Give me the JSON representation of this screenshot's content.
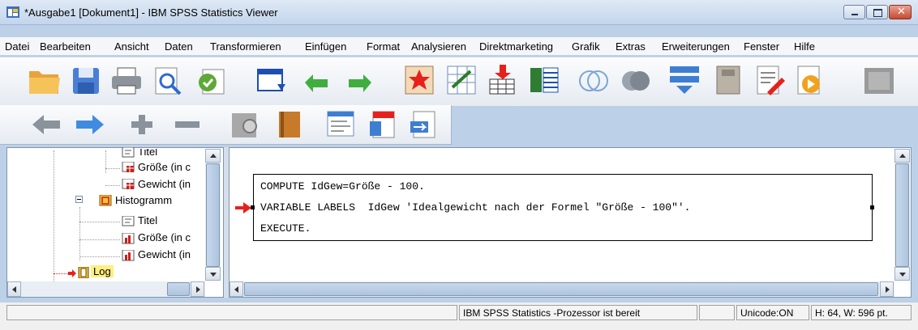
{
  "window": {
    "title": "*Ausgabe1 [Dokument1] - IBM SPSS Statistics Viewer"
  },
  "menu": [
    "Datei",
    "Bearbeiten",
    "Ansicht",
    "Daten",
    "Transformieren",
    "Einfügen",
    "Format",
    "Analysieren",
    "Direktmarketing",
    "Grafik",
    "Extras",
    "Erweiterungen",
    "Fenster",
    "Hilfe"
  ],
  "toolbar1": [
    "open-folder-icon",
    "save-icon",
    "print-icon",
    "print-preview-icon",
    "export-icon",
    "recall-dialog-icon",
    "undo-icon",
    "redo-icon",
    "goto-data-icon",
    "goto-case-icon",
    "goto-variable-icon",
    "variables-icon",
    "venn-icon",
    "circles-icon",
    "split-file-icon",
    "weight-cases-icon",
    "select-cases-icon",
    "show-value-labels-icon",
    "designated-window-icon"
  ],
  "toolbar2": [
    "back-arrow-icon",
    "forward-arrow-icon",
    "expand-icon",
    "collapse-icon",
    "show-icon",
    "hide-icon",
    "insert-heading-icon",
    "insert-title-icon",
    "insert-text-icon"
  ],
  "tree": {
    "items": [
      {
        "label": "Titel"
      },
      {
        "label": "Größe (in c"
      },
      {
        "label": "Gewicht (in"
      },
      {
        "label": "Histogramm"
      },
      {
        "label": "Titel"
      },
      {
        "label": "Größe (in c"
      },
      {
        "label": "Gewicht (in"
      },
      {
        "label": "Log"
      }
    ]
  },
  "log": {
    "lines": [
      "COMPUTE IdGew=Größe - 100.",
      "VARIABLE LABELS  IdGew 'Idealgewicht nach der Formel \"Größe - 100\"'.",
      "EXECUTE."
    ]
  },
  "status": {
    "processor": "IBM SPSS Statistics -Prozessor ist bereit",
    "unicode": "Unicode:ON",
    "size": "H: 64, W: 596 pt."
  },
  "colors": {
    "accent_red": "#e8201c",
    "selection_yellow": "#ffee80"
  }
}
